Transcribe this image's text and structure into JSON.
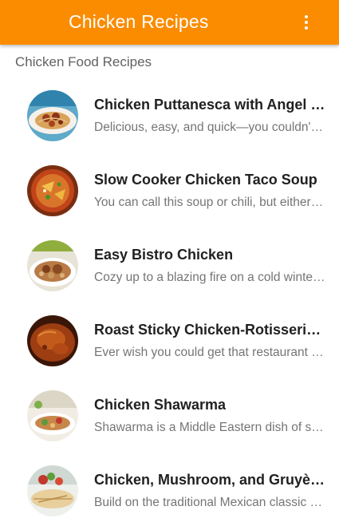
{
  "appbar": {
    "title": "Chicken Recipes",
    "overflow_icon": "more-vert-icon",
    "color": "#fb8c00"
  },
  "section": {
    "header": "Chicken Food Recipes"
  },
  "recipes": [
    {
      "title": "Chicken Puttanesca with Angel Hair Pasta",
      "description": "Delicious, easy, and quick—you couldn't ask for more",
      "image": "pasta-dish-photo"
    },
    {
      "title": "Slow Cooker Chicken Taco Soup",
      "description": "You can call this soup or chili, but either way it's delicious",
      "image": "taco-soup-photo"
    },
    {
      "title": "Easy Bistro Chicken",
      "description": "Cozy up to a blazing fire on a cold winter night",
      "image": "bistro-chicken-photo"
    },
    {
      "title": "Roast Sticky Chicken-Rotisserie Style",
      "description": "Ever wish you could get that restaurant taste at home",
      "image": "roast-chicken-photo"
    },
    {
      "title": "Chicken Shawarma",
      "description": "Shawarma is a Middle Eastern dish of spiced meat",
      "image": "shawarma-photo"
    },
    {
      "title": "Chicken, Mushroom, and Gruyère Quesadillas",
      "description": "Build on the traditional Mexican classic with new flavors",
      "image": "quesadilla-photo"
    }
  ]
}
